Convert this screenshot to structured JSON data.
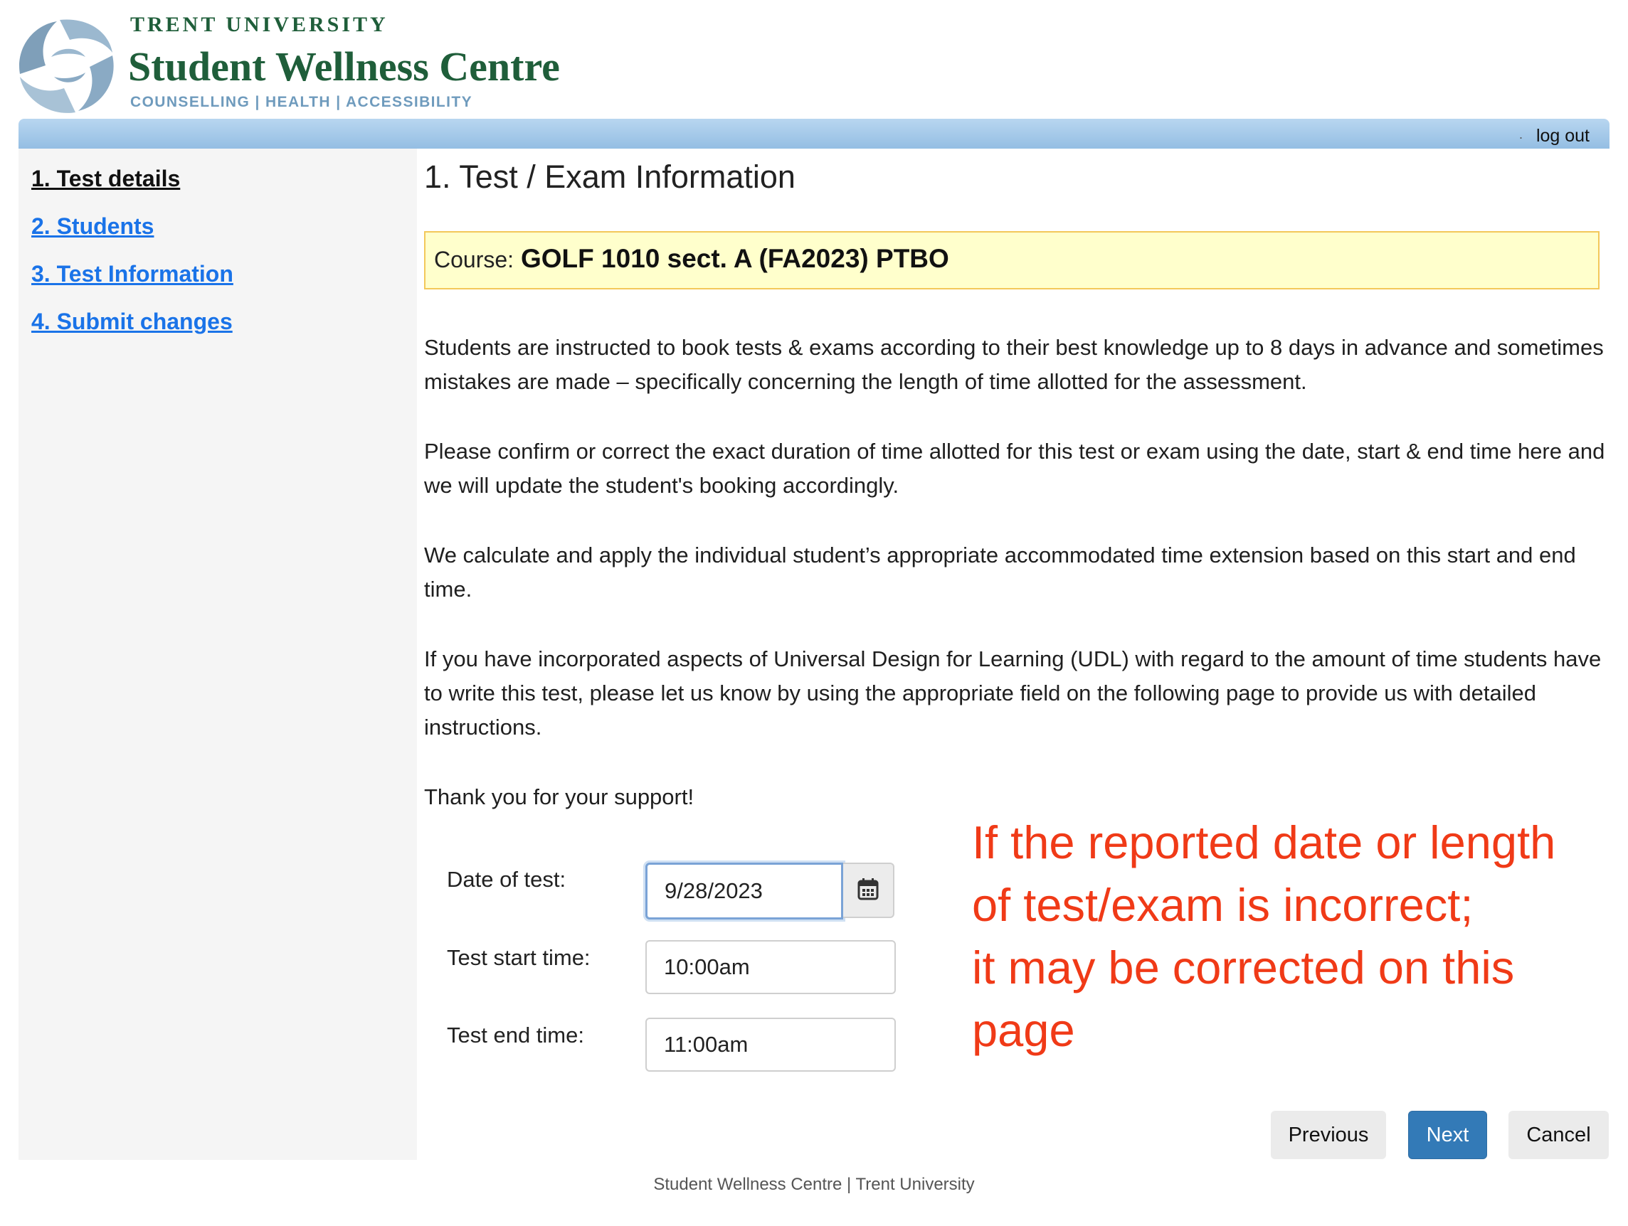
{
  "header": {
    "university": "TRENT UNIVERSITY",
    "centre": "Student Wellness Centre",
    "tagline": "COUNSELLING | HEALTH | ACCESSIBILITY"
  },
  "topbar": {
    "logout_label": "log out",
    "dot": "."
  },
  "sidebar": {
    "items": [
      {
        "label": "1. Test details",
        "current": true
      },
      {
        "label": "2. Students",
        "current": false
      },
      {
        "label": "3. Test Information",
        "current": false
      },
      {
        "label": "4. Submit changes",
        "current": false
      }
    ]
  },
  "main": {
    "title": "1. Test / Exam Information",
    "course_label": "Course:",
    "course_value": "GOLF 1010 sect. A (FA2023) PTBO",
    "paragraphs": [
      "Students are instructed to book tests & exams according to their best knowledge up to 8 days in advance and sometimes mistakes are made – specifically concerning the length of time allotted for the assessment.",
      "Please confirm or correct the exact duration of time allotted for this test or exam using the date, start & end time here and we will update the student's booking accordingly.",
      "We calculate and apply the individual student’s appropriate accommodated time extension based on this start and end time.",
      "If you have incorporated aspects of Universal Design for Learning (UDL) with regard to the amount of time students have to write this test, please let us know by using the appropriate field on the following page to provide us with detailed instructions.",
      "Thank you for your support!"
    ],
    "form": {
      "date_label": "Date of test:",
      "date_value": "9/28/2023",
      "start_label": "Test start time:",
      "start_value": "10:00am",
      "end_label": "Test end time:",
      "end_value": "11:00am"
    },
    "annotation": "If the reported date or length of test/exam is incorrect;\nit may be corrected on this page",
    "buttons": {
      "previous": "Previous",
      "next": "Next",
      "cancel": "Cancel"
    }
  },
  "footer": {
    "text": "Student Wellness Centre | Trent University"
  },
  "colors": {
    "brand_green": "#1f5e3a",
    "link_blue": "#1a73e8",
    "primary_button": "#337ab7",
    "annotation_red": "#f03a17",
    "course_box_bg": "#ffffcc"
  }
}
